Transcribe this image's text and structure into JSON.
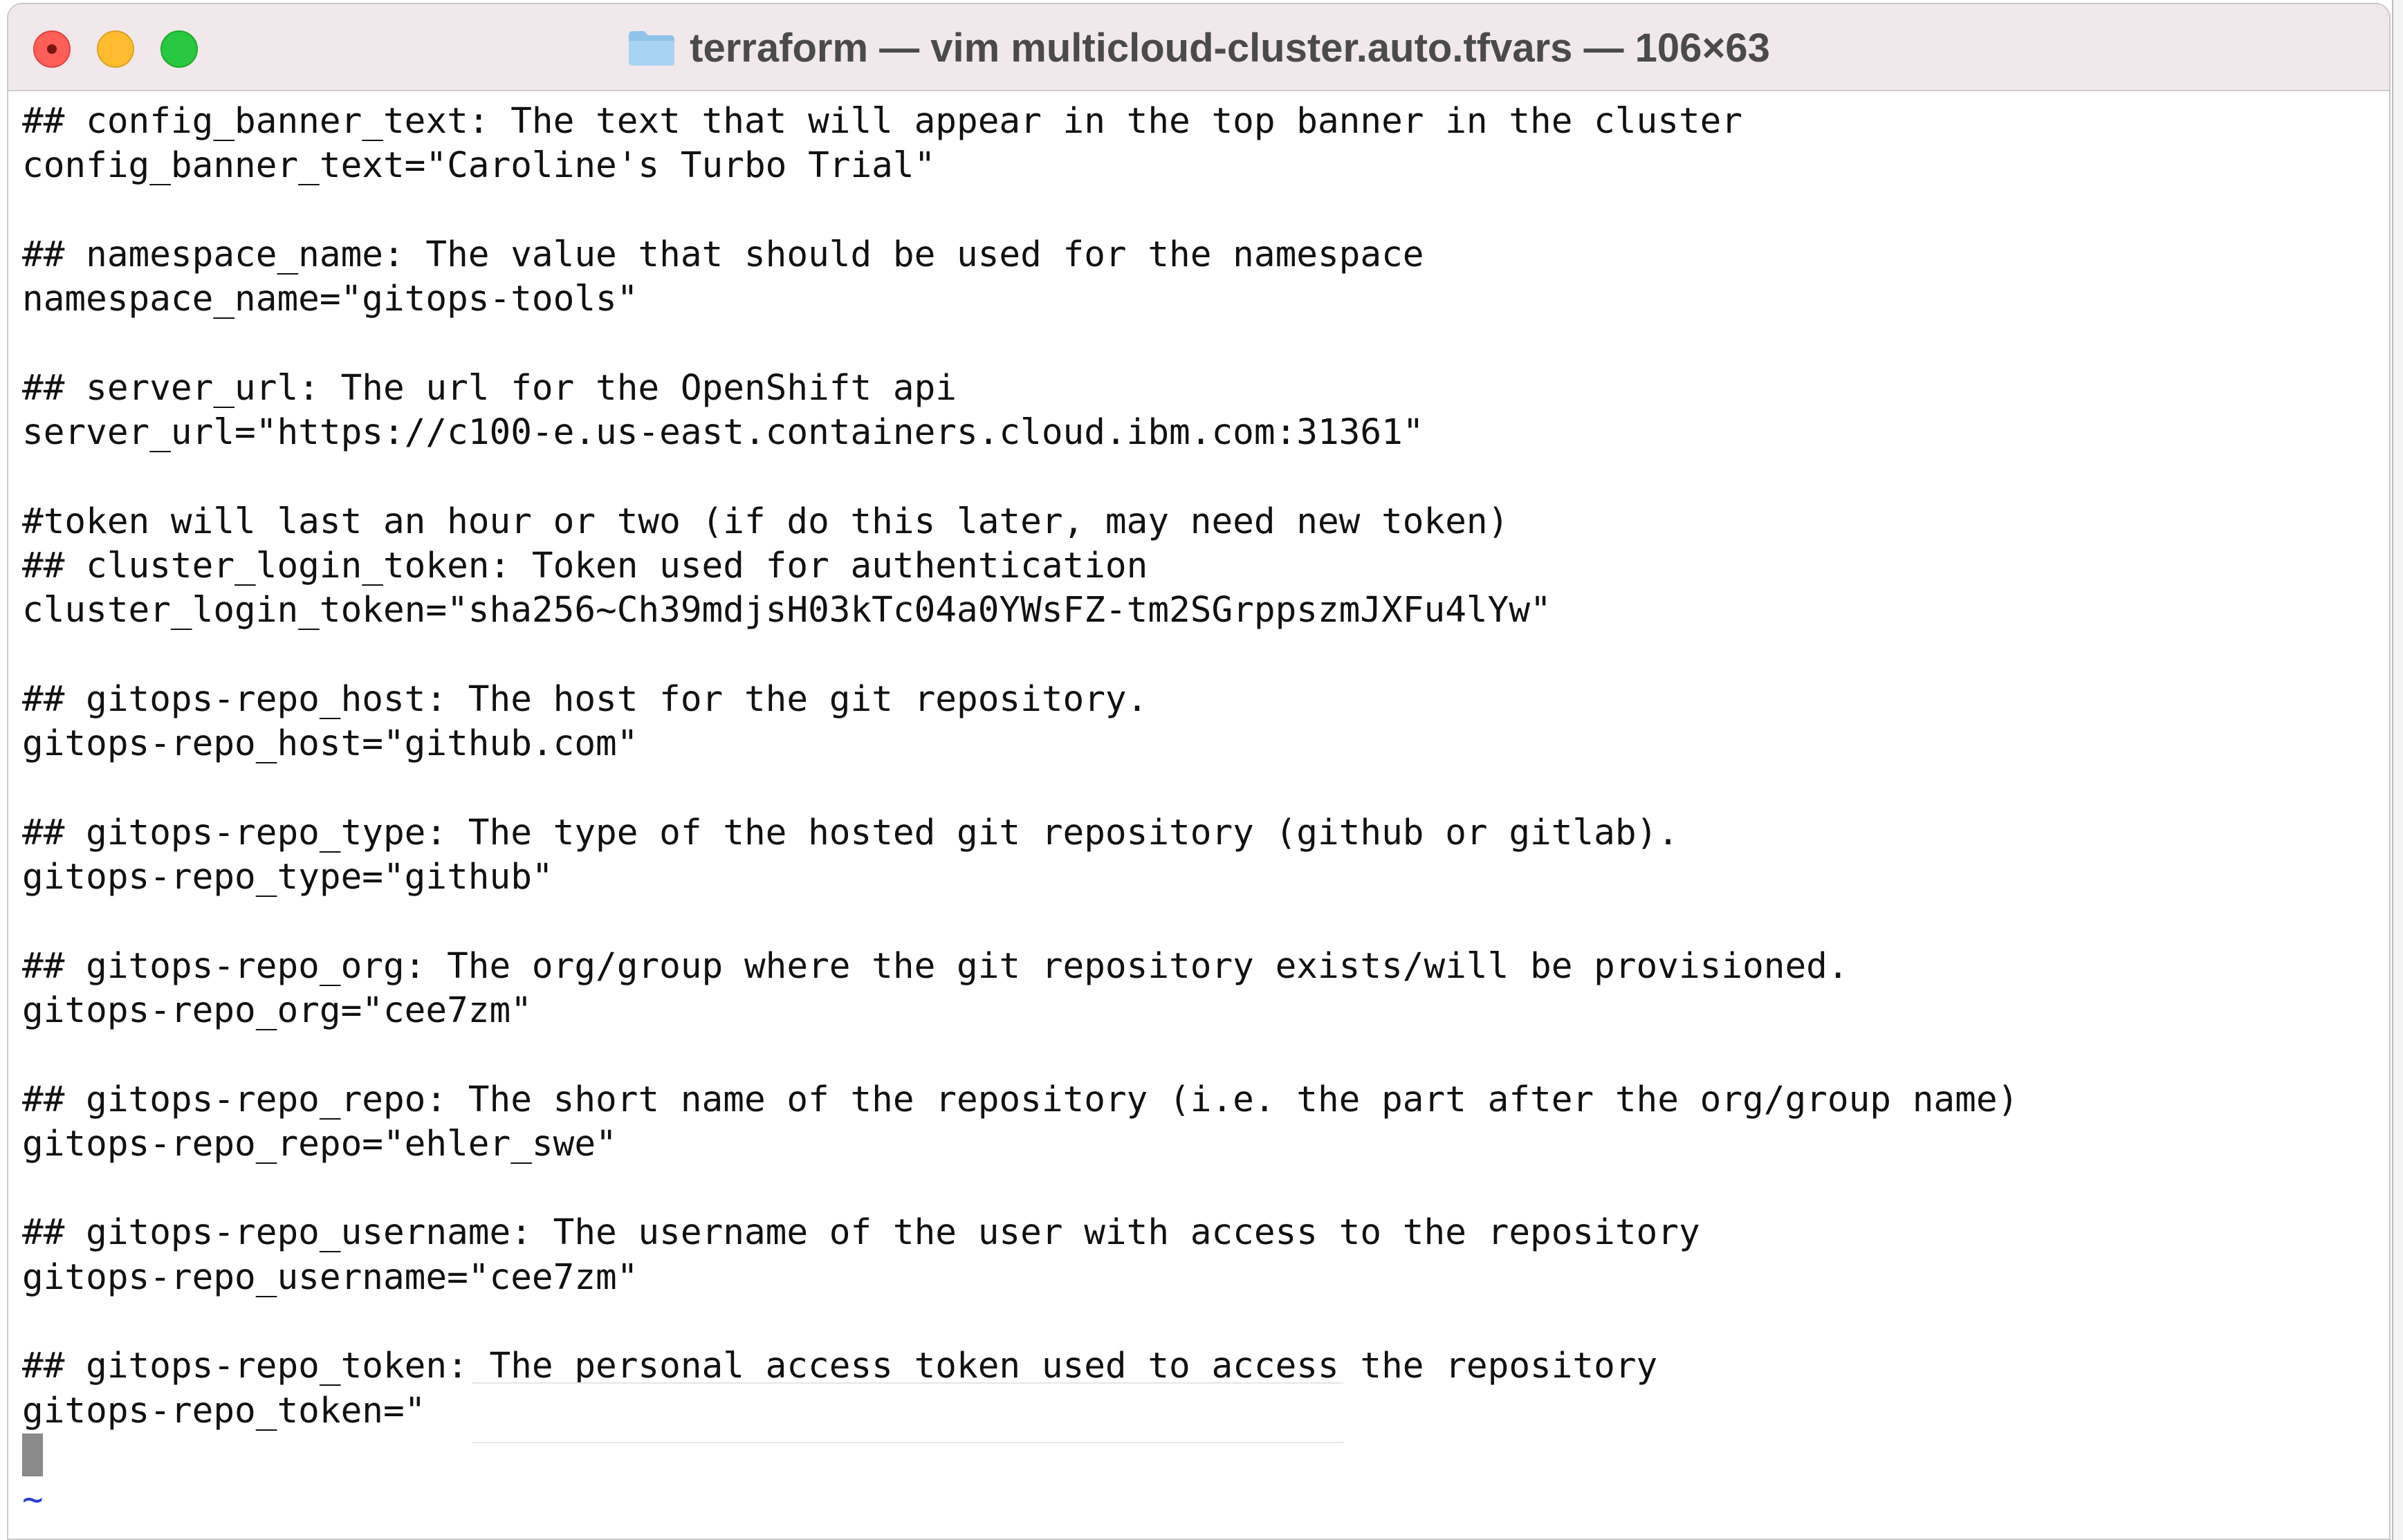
{
  "window": {
    "title": "terraform — vim multicloud-cluster.auto.tfvars — 106×63",
    "folder_icon": "folder-icon",
    "buttons": [
      "close",
      "minimize",
      "zoom"
    ]
  },
  "editor": {
    "lines": [
      "## config_banner_text: The text that will appear in the top banner in the cluster",
      "config_banner_text=\"Caroline's Turbo Trial\"",
      "",
      "## namespace_name: The value that should be used for the namespace",
      "namespace_name=\"gitops-tools\"",
      "",
      "## server_url: The url for the OpenShift api",
      "server_url=\"https://c100-e.us-east.containers.cloud.ibm.com:31361\"",
      "",
      "#token will last an hour or two (if do this later, may need new token)",
      "## cluster_login_token: Token used for authentication",
      "cluster_login_token=\"sha256~Ch39mdjsH03kTc04a0YWsFZ-tm2SGrppszmJXFu4lYw\"",
      "",
      "## gitops-repo_host: The host for the git repository.",
      "gitops-repo_host=\"github.com\"",
      "",
      "## gitops-repo_type: The type of the hosted git repository (github or gitlab).",
      "gitops-repo_type=\"github\"",
      "",
      "## gitops-repo_org: The org/group where the git repository exists/will be provisioned.",
      "gitops-repo_org=\"cee7zm\"",
      "",
      "## gitops-repo_repo: The short name of the repository (i.e. the part after the org/group name)",
      "gitops-repo_repo=\"ehler_swe\"",
      "",
      "## gitops-repo_username: The username of the user with access to the repository",
      "gitops-repo_username=\"cee7zm\"",
      "",
      "## gitops-repo_token: The personal access token used to access the repository",
      "gitops-repo_token=\"                                       \""
    ],
    "tilde_lines": [
      "~",
      "~"
    ],
    "colors": {
      "text": "#111111",
      "tilde": "#2b3fd1",
      "cursor": "#8a8a8a"
    }
  }
}
